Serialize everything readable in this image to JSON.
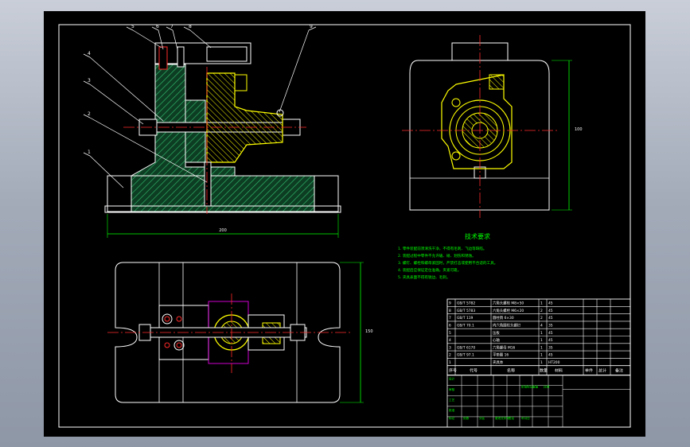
{
  "drawing": {
    "leader_labels": [
      "5",
      "6",
      "7",
      "8",
      "4",
      "3",
      "2",
      "1",
      "9"
    ],
    "base_width_dim": "200",
    "side_height_dim": "100",
    "plan_height_dim": "150",
    "tech_title": "技术要求",
    "tech_lines": [
      "1. 零件装配前须清洗干净，不得有毛刺、飞边等缺陷。",
      "2. 装配过程中零件不允许磕、碰、划伤和锈蚀。",
      "3. 螺钉、螺栓和螺母紧固时，严禁打击或使用不合适的工具。",
      "4. 装配后应保证定位准确，夹紧可靠。",
      "5. 夹具表面不得有锐边、毛刺。"
    ],
    "bom_header": [
      "序号",
      "代号",
      "名称",
      "数量",
      "材料",
      "单件",
      "总计",
      "备注"
    ],
    "bom_rows": [
      [
        "9",
        "GB/T 5782",
        "六角头螺栓 M8×50",
        "1",
        "45",
        ""
      ],
      [
        "8",
        "GB/T 5783",
        "六角头螺栓 M6×20",
        "2",
        "45",
        ""
      ],
      [
        "7",
        "GB/T 119",
        "圆柱销 6×30",
        "2",
        "45",
        ""
      ],
      [
        "6",
        "GB/T 70.1",
        "内六角圆柱头螺钉",
        "4",
        "35",
        ""
      ],
      [
        "5",
        "",
        "压板",
        "1",
        "45",
        ""
      ],
      [
        "4",
        "",
        "心轴",
        "1",
        "45",
        ""
      ],
      [
        "3",
        "GB/T 6170",
        "六角螺母 M16",
        "1",
        "35",
        ""
      ],
      [
        "2",
        "GB/T 97.1",
        "平垫圈 16",
        "1",
        "45",
        ""
      ],
      [
        "1",
        "",
        "夹具体",
        "1",
        "HT200",
        ""
      ]
    ],
    "title_block": [
      "标记",
      "处数",
      "分区",
      "更改文件号",
      "签名",
      "年月日",
      "设计",
      "审核",
      "工艺",
      "批准",
      "阶段标记",
      "重量",
      "比例"
    ]
  },
  "colors": {
    "bg": "#000000",
    "frame": "#ffffff",
    "yellow": "#ffff00",
    "green": "#00ff00",
    "hatch": "#1e8c48",
    "red": "#ff2a2a",
    "magenta": "#ff00ff",
    "white": "#e8e8e8"
  }
}
